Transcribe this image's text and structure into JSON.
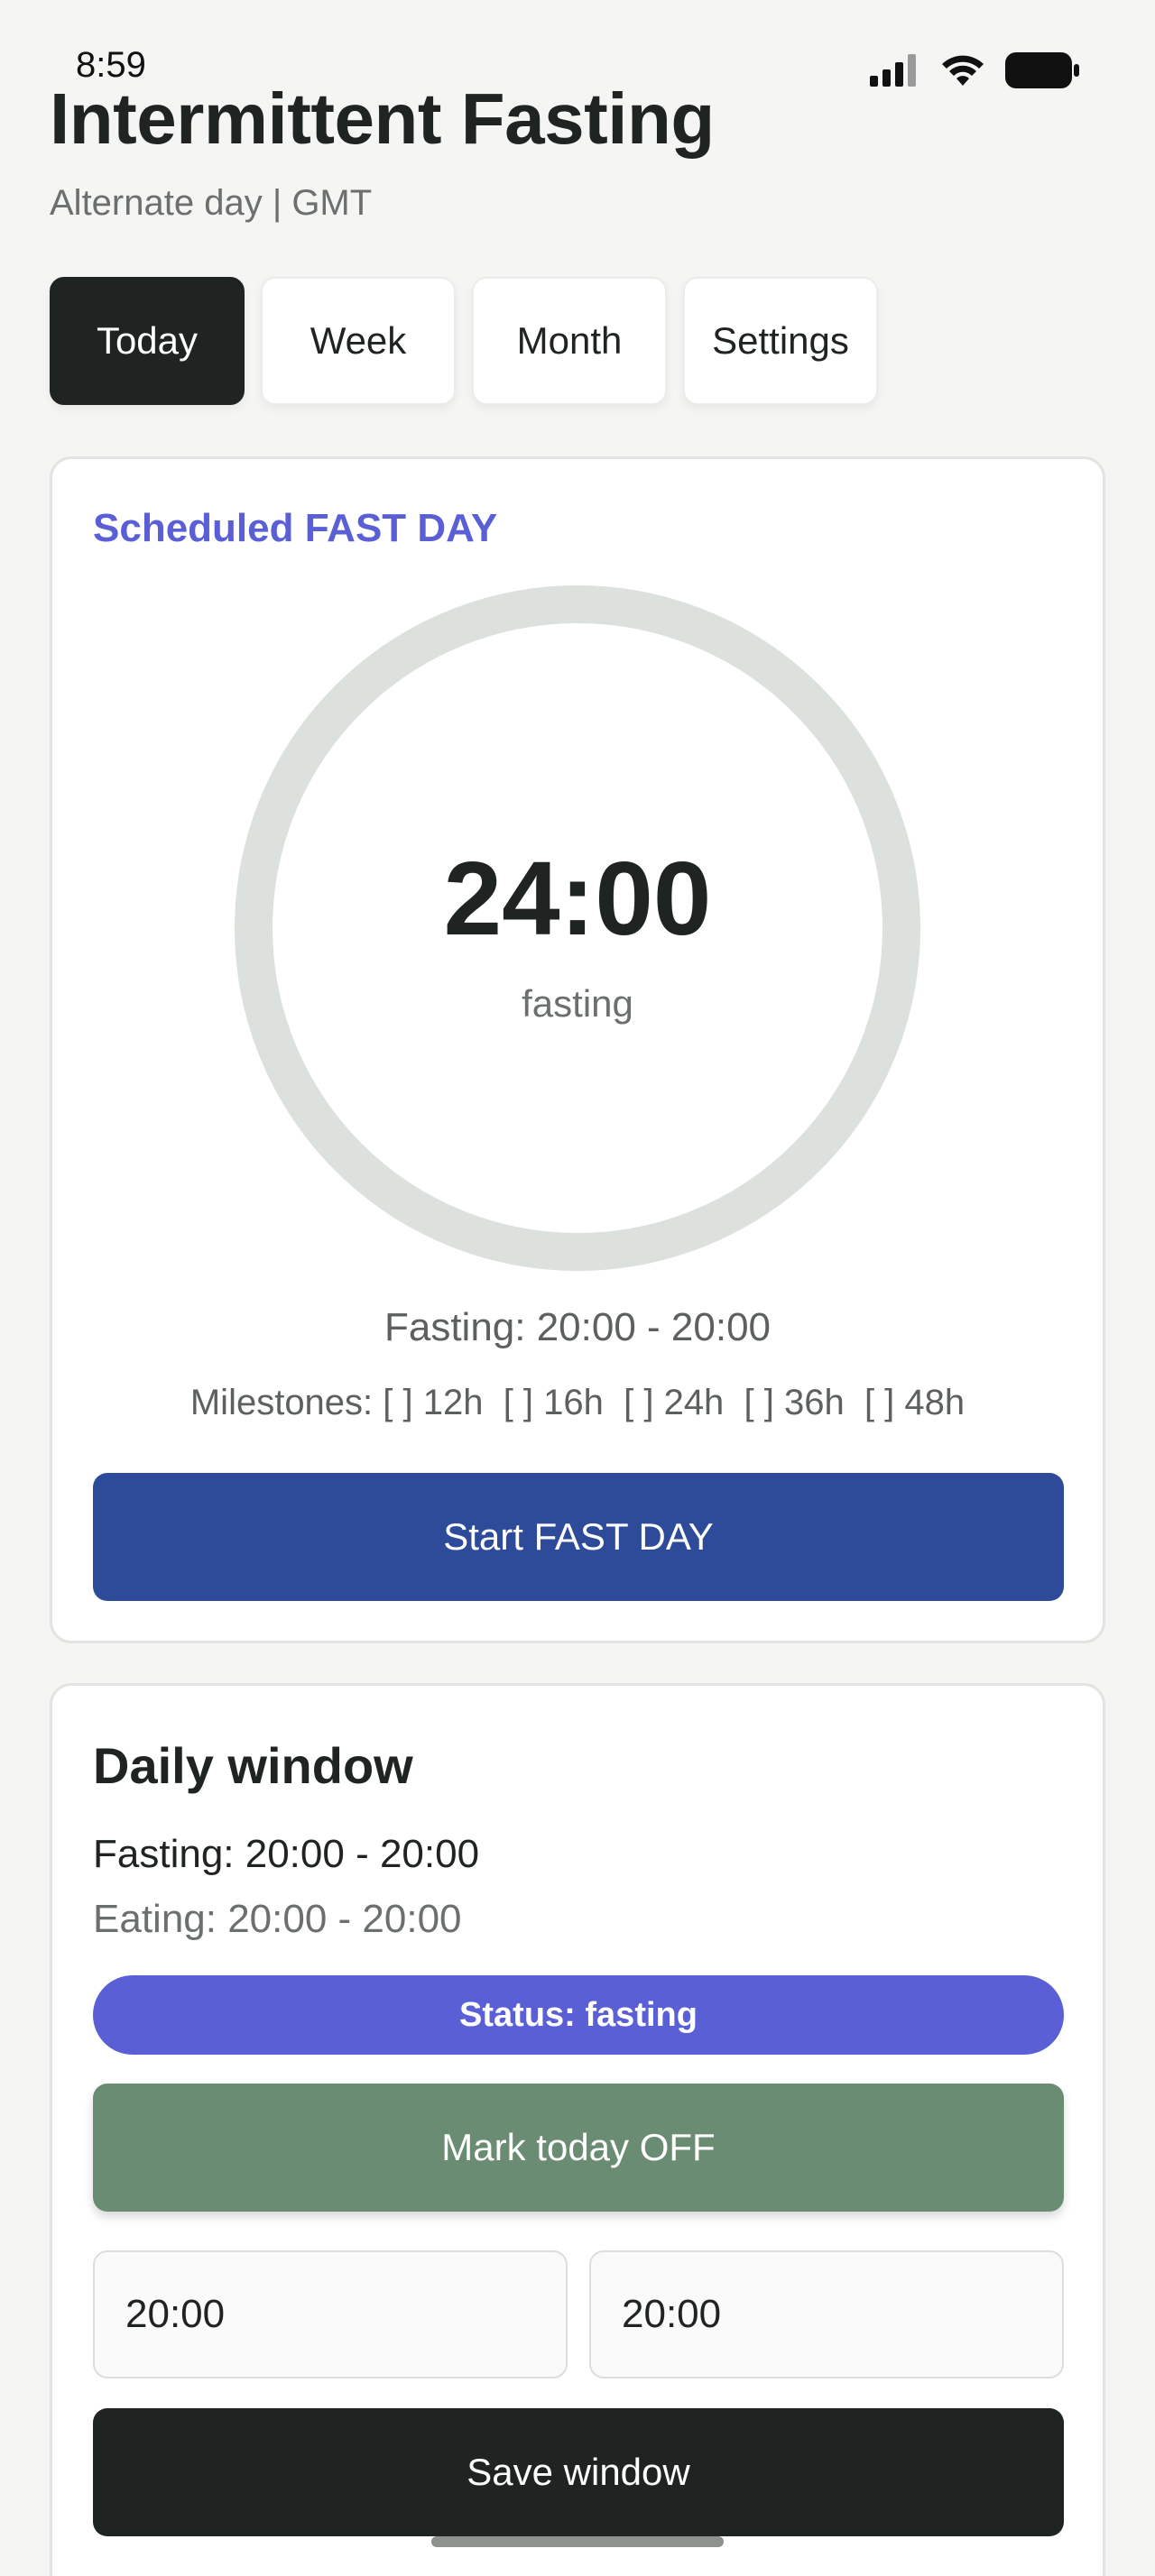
{
  "status_bar": {
    "time": "8:59",
    "icons": [
      "signal-icon",
      "wifi-icon",
      "battery-icon"
    ]
  },
  "header": {
    "title": "Intermittent Fasting",
    "subtitle": "Alternate day | GMT"
  },
  "tabs": [
    {
      "label": "Today",
      "active": true
    },
    {
      "label": "Week",
      "active": false
    },
    {
      "label": "Month",
      "active": false
    },
    {
      "label": "Settings",
      "active": false
    }
  ],
  "fast_card": {
    "scheduled_label": "Scheduled FAST DAY",
    "timer_value": "24:00",
    "timer_caption": "fasting",
    "progress_fraction": 0,
    "fasting_range": "Fasting: 20:00 - 20:00",
    "milestones": "Milestones: [ ] 12h  [ ] 16h  [ ] 24h  [ ] 36h  [ ] 48h",
    "start_button": "Start FAST DAY"
  },
  "window_card": {
    "title": "Daily window",
    "fasting": "Fasting: 20:00 - 20:00",
    "eating": "Eating: 20:00 - 20:00",
    "status": "Status: fasting",
    "mark_off_button": "Mark today OFF",
    "start_time": "20:00",
    "end_time": "20:00",
    "save_button": "Save window"
  },
  "colors": {
    "accent": "#5a5fd6",
    "primary_button": "#2d4b99",
    "off_button": "#6a8c73",
    "dark": "#1f2322",
    "ring_track": "#dde1de"
  }
}
